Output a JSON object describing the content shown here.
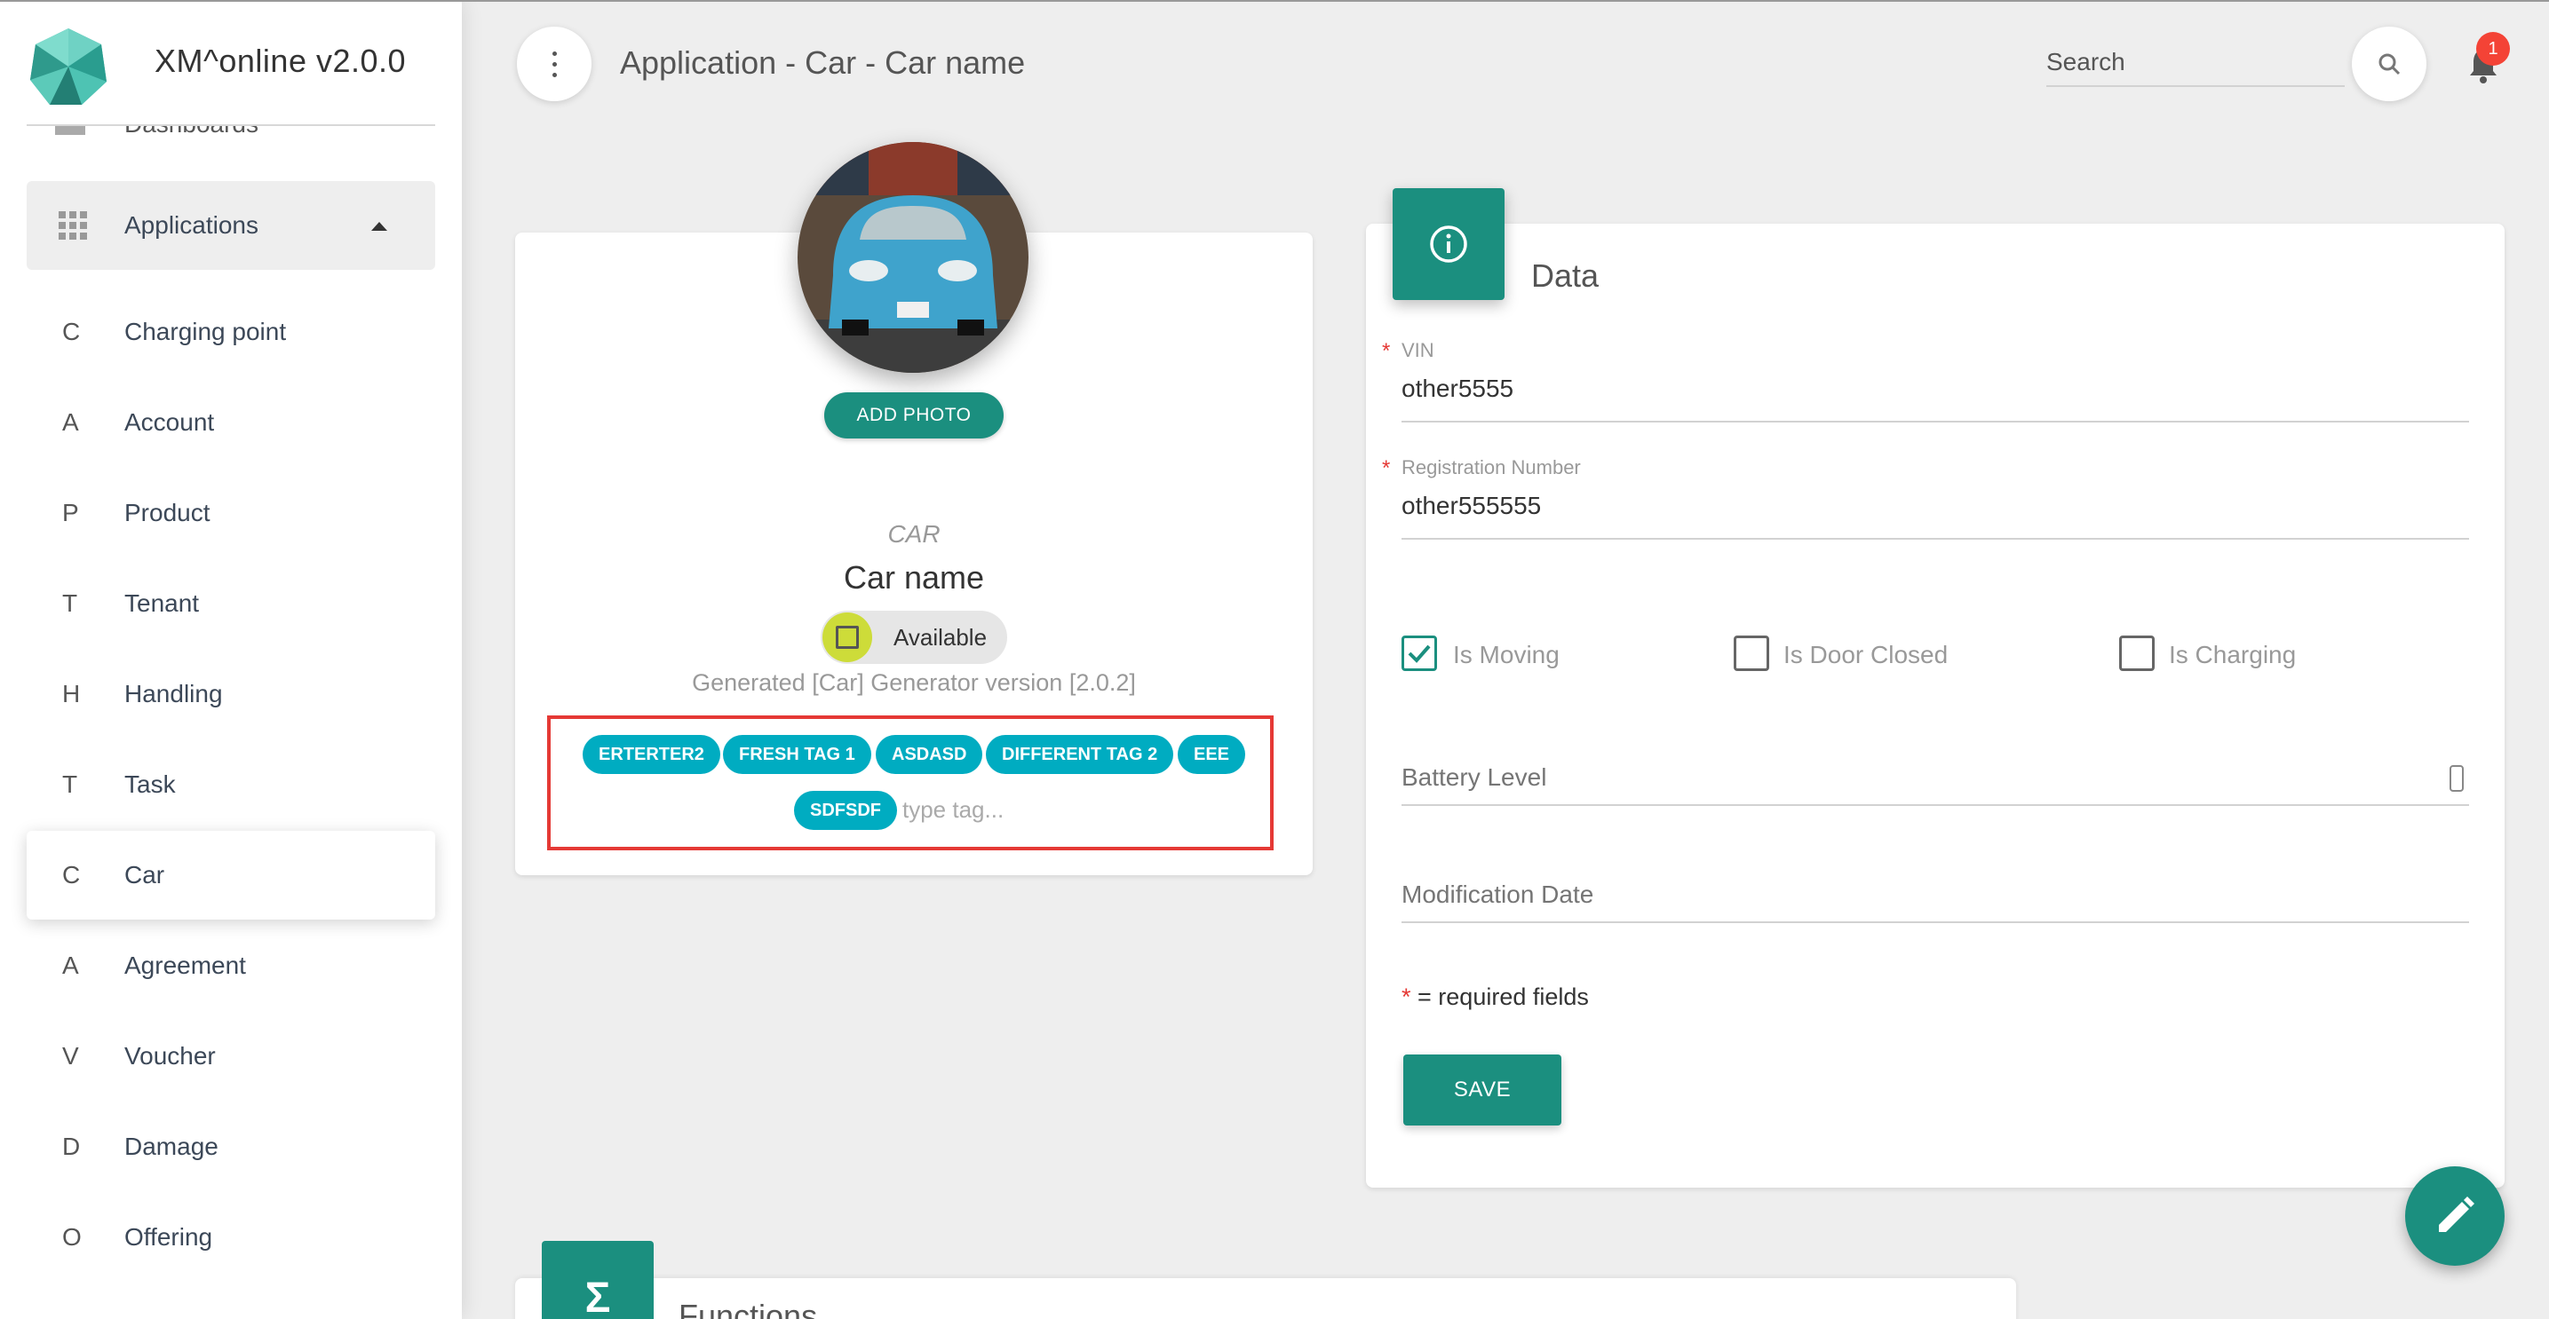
{
  "app": {
    "name": "XM^online v2.0.0"
  },
  "sidebar": {
    "partial_item": "Dashboards",
    "group": {
      "label": "Applications"
    },
    "items": [
      {
        "letter": "C",
        "label": "Charging point"
      },
      {
        "letter": "A",
        "label": "Account"
      },
      {
        "letter": "P",
        "label": "Product"
      },
      {
        "letter": "T",
        "label": "Tenant"
      },
      {
        "letter": "H",
        "label": "Handling"
      },
      {
        "letter": "T",
        "label": "Task"
      },
      {
        "letter": "C",
        "label": "Car",
        "active": true
      },
      {
        "letter": "A",
        "label": "Agreement"
      },
      {
        "letter": "V",
        "label": "Voucher"
      },
      {
        "letter": "D",
        "label": "Damage"
      },
      {
        "letter": "O",
        "label": "Offering"
      }
    ]
  },
  "header": {
    "title": "Application - Car - Car name",
    "search_placeholder": "Search",
    "notifications_count": "1"
  },
  "profile": {
    "add_photo_label": "ADD PHOTO",
    "entity_type": "CAR",
    "entity_name": "Car name",
    "state": "Available",
    "generated_text": "Generated [Car] Generator version [2.0.2]",
    "tags": [
      "ERTERTER2",
      "FRESH TAG 1",
      "ASDASD",
      "DIFFERENT TAG 2",
      "EEE",
      "SDFSDF"
    ],
    "tag_placeholder": "type tag..."
  },
  "data_form": {
    "title": "Data",
    "vin_label": "VIN",
    "vin_value": "other5555",
    "reg_label": "Registration Number",
    "reg_value": "other555555",
    "checkboxes": [
      {
        "label": "Is Moving",
        "checked": true
      },
      {
        "label": "Is Door Closed",
        "checked": false
      },
      {
        "label": "Is Charging",
        "checked": false
      }
    ],
    "battery_placeholder": "Battery Level",
    "modification_placeholder": "Modification Date",
    "required_note": "= required fields",
    "save_label": "SAVE"
  },
  "functions": {
    "title": "Functions"
  },
  "colors": {
    "primary": "#1b8f7f",
    "tag": "#00acc1",
    "highlight_border": "#e53935",
    "state": "#cddc39"
  }
}
